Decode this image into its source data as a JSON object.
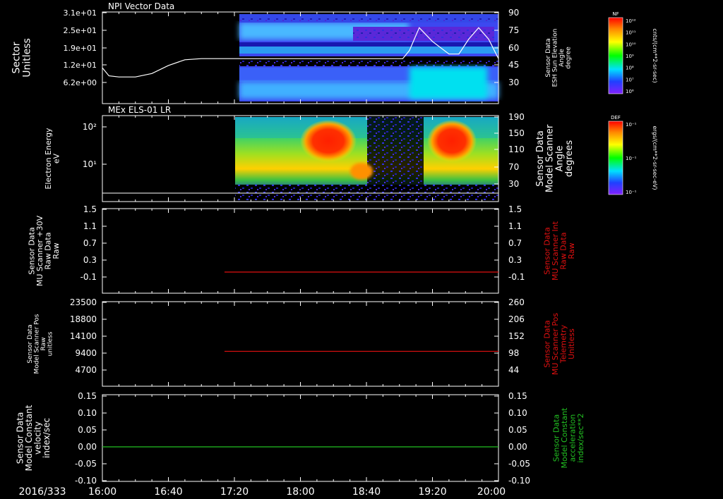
{
  "chart_data": [
    {
      "type": "heatmap",
      "title": "NPI Vector Data",
      "ylabel": [
        "Sector",
        "Unitless"
      ],
      "yticks": [
        "3.1e+01",
        "2.5e+01",
        "1.9e+01",
        "1.2e+01",
        "6.2e+00"
      ],
      "y2label": [
        "Sensor Data",
        "ESH Sun Elevation",
        "Angle",
        "degree"
      ],
      "y2ticks": [
        "90",
        "75",
        "60",
        "45",
        "30"
      ],
      "y2lim": [
        15,
        90
      ],
      "colorbar": {
        "title": "NF",
        "units": "cnts/(cm**2-sr-sec)",
        "ticks": [
          "10¹²",
          "10¹¹",
          "10¹⁰",
          "10⁹",
          "10⁸",
          "10⁷",
          "10⁶"
        ]
      },
      "overlay_line": {
        "name": "ESH Sun Elevation Angle",
        "x": [
          "16:00",
          "16:04",
          "16:10",
          "16:20",
          "16:30",
          "16:40",
          "16:50",
          "17:00",
          "17:20",
          "18:40",
          "19:02",
          "19:06",
          "19:12",
          "19:20",
          "19:30",
          "19:36",
          "19:42",
          "19:48",
          "19:54",
          "20:00"
        ],
        "y": [
          45,
          38,
          37,
          37,
          40,
          47,
          52,
          53,
          53,
          53,
          53,
          60,
          80,
          68,
          57,
          57,
          70,
          80,
          70,
          53
        ]
      },
      "data_start": "17:22"
    },
    {
      "type": "heatmap",
      "title": "MEx ELS-01 LR",
      "ylabel": [
        "Electron Energy",
        "eV"
      ],
      "yticks": [
        "10²",
        "10¹"
      ],
      "y2label": [
        "Sensor Data",
        "Model Scanner",
        "Angle",
        "degrees"
      ],
      "y2ticks": [
        "190",
        "150",
        "110",
        "70",
        "30"
      ],
      "y2lim": [
        10,
        190
      ],
      "colorbar": {
        "title": "DEF",
        "units": "ergs/(cm**2-sr-sec-eV)",
        "ticks": [
          "10⁻¹",
          "10⁻¹",
          "10⁻¹"
        ]
      },
      "overlay_line": {
        "name": "Model Scanner Angle",
        "x": [
          "16:00",
          "20:00"
        ],
        "y": [
          10,
          10
        ]
      },
      "data_start": "17:20"
    },
    {
      "type": "line",
      "ylabel": [
        "Sensor Data",
        "MU Scanner +30V",
        "Raw Data",
        "Raw"
      ],
      "yticks": [
        "1.5",
        "1.1",
        "0.7",
        "0.3",
        "-0.1"
      ],
      "ylim": [
        -0.5,
        1.5
      ],
      "y2label": [
        "Sensor Data",
        "MU Scanner Int",
        "Raw Data",
        "Raw"
      ],
      "y2ticks": [
        "1.5",
        "1.1",
        "0.7",
        "0.3",
        "-0.1"
      ],
      "series": [
        {
          "name": "MU Scanner Int Raw Data",
          "color": "#e01010",
          "x": [
            "17:14",
            "20:00"
          ],
          "y": [
            -0.03,
            -0.03
          ]
        }
      ]
    },
    {
      "type": "line",
      "ylabel": [
        "Sensor Data",
        "Model Scanner Pos",
        "Raw",
        "unitless"
      ],
      "yticks": [
        "23500",
        "18800",
        "14100",
        "9400",
        "4700"
      ],
      "ylim": [
        0,
        23500
      ],
      "y2label": [
        "Sensor Data",
        "MU Scanner Pos",
        "Telemetry",
        "Unitless"
      ],
      "y2ticks": [
        "260",
        "206",
        "152",
        "98",
        "44"
      ],
      "y2lim": [
        0,
        260
      ],
      "series": [
        {
          "name": "MU Scanner Pos Telemetry",
          "color": "#e01010",
          "x": [
            "17:14",
            "20:00"
          ],
          "y": [
            8000,
            8000
          ]
        }
      ]
    },
    {
      "type": "line",
      "ylabel": [
        "Sensor Data",
        "Model Constant",
        "velocity",
        "index/sec"
      ],
      "yticks": [
        "0.15",
        "0.10",
        "0.05",
        "0.00",
        "-0.05",
        "-0.10"
      ],
      "ylim": [
        -0.1,
        0.15
      ],
      "y2label": [
        "Sensor Data",
        "Model Constant",
        "acceleration",
        "index/sec**2"
      ],
      "y2ticks": [
        "0.15",
        "0.10",
        "0.05",
        "0.00",
        "-0.05",
        "-0.10"
      ],
      "series": [
        {
          "name": "Model Constant",
          "color": "#22c022",
          "x": [
            "16:00",
            "20:00"
          ],
          "y": [
            0.0,
            0.0
          ]
        }
      ]
    }
  ],
  "xaxis": {
    "date": "2016/333",
    "range": [
      "16:00",
      "20:00"
    ],
    "ticks": [
      "16:00",
      "16:40",
      "17:20",
      "18:00",
      "18:40",
      "19:20",
      "20:00"
    ]
  },
  "colors": {
    "red_label": "#e01010",
    "green_label": "#22c022"
  }
}
